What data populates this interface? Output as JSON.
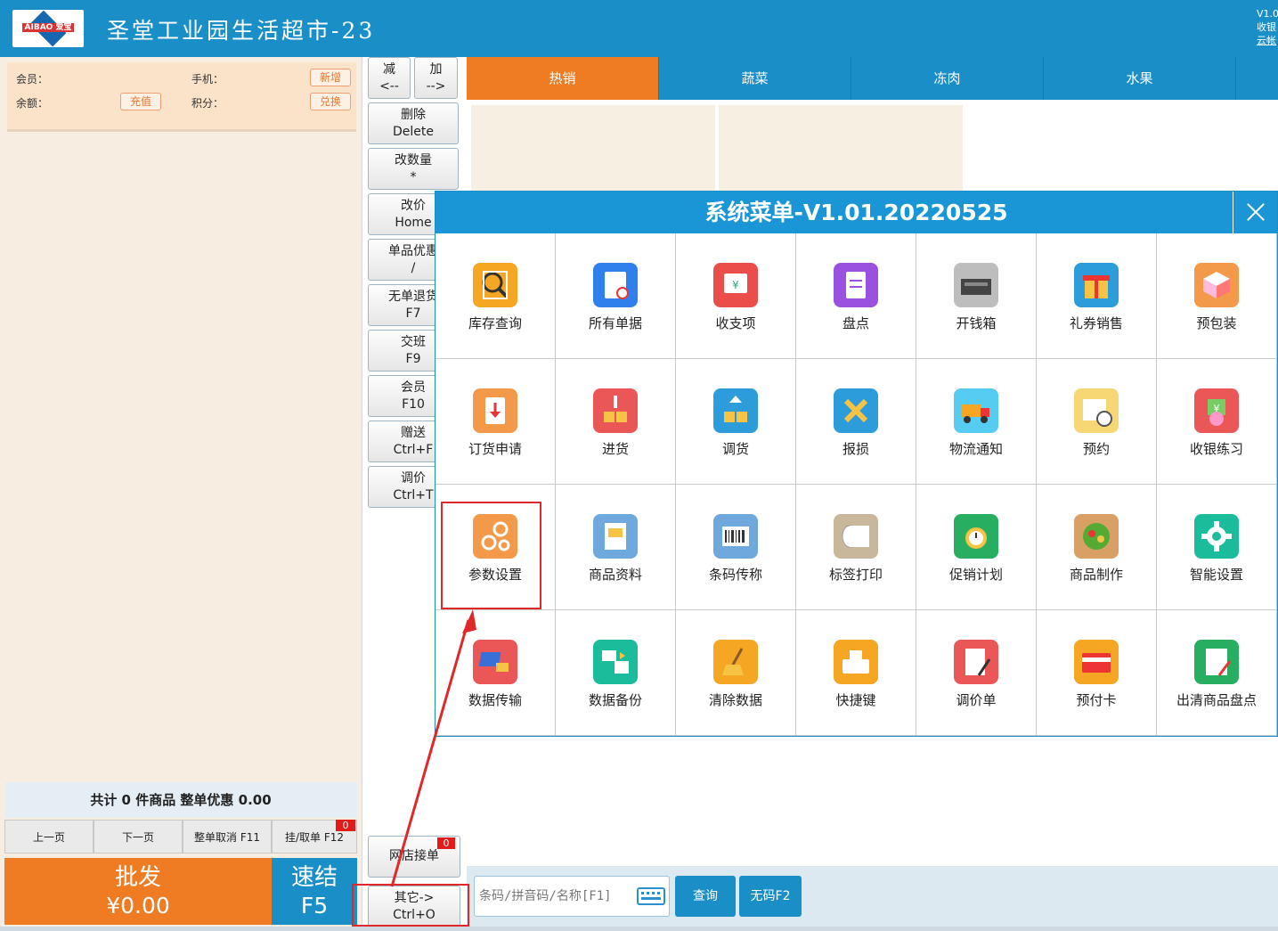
{
  "header": {
    "logo_text": "AIBAO 爱宝",
    "store_name": "圣堂工业园生活超市-23",
    "version": "V1.0",
    "cashier": "收银",
    "cloud_link": "云帐"
  },
  "member": {
    "member_label": "会员：",
    "phone_label": "手机：",
    "balance_label": "余额：",
    "points_label": "积分：",
    "recharge_btn": "充值",
    "new_btn": "新增",
    "redeem_btn": "兑换"
  },
  "summary": "共计 0 件商品 整单优惠 0.00",
  "pager": {
    "prev": "上一页",
    "next": "下一页",
    "cancel_all": "整单取消 F11",
    "hold": "挂/取单 F12",
    "hold_badge": "0"
  },
  "wholesale": {
    "label": "批发",
    "amount": "¥0.00"
  },
  "quick_settle": {
    "label": "速结",
    "key": "F5"
  },
  "functions": [
    {
      "name": "minus",
      "l1": "减",
      "l2": "<--"
    },
    {
      "name": "plus",
      "l1": "加",
      "l2": "-->"
    },
    {
      "name": "delete",
      "l1": "删除",
      "l2": "Delete"
    },
    {
      "name": "change-qty",
      "l1": "改数量",
      "l2": "*"
    },
    {
      "name": "change-price",
      "l1": "改价",
      "l2": "Home"
    },
    {
      "name": "item-discount",
      "l1": "单品优惠",
      "l2": "/"
    },
    {
      "name": "no-receipt-return",
      "l1": "无单退货",
      "l2": "F7"
    },
    {
      "name": "shift",
      "l1": "交班",
      "l2": "F9"
    },
    {
      "name": "member",
      "l1": "会员",
      "l2": "F10"
    },
    {
      "name": "gift",
      "l1": "赠送",
      "l2": "Ctrl+F"
    },
    {
      "name": "adjust-price",
      "l1": "调价",
      "l2": "Ctrl+T"
    }
  ],
  "online_orders": {
    "label": "网店接单",
    "badge": "0"
  },
  "other": {
    "l1": "其它->",
    "l2": "Ctrl+O"
  },
  "tabs": [
    "热销",
    "蔬菜",
    "冻肉",
    "水果"
  ],
  "search": {
    "placeholder": "条码/拼音码/名称[F1]",
    "query_btn": "查询",
    "nocode_btn": "无码F2"
  },
  "modal": {
    "title": "系统菜单-V1.01.20220525",
    "items": [
      {
        "label": "库存查询",
        "icon": "inventory-search-icon",
        "color": "#f5a623"
      },
      {
        "label": "所有单据",
        "icon": "all-documents-icon",
        "color": "#2f80ed"
      },
      {
        "label": "收支项",
        "icon": "income-expense-icon",
        "color": "#eb4d4b"
      },
      {
        "label": "盘点",
        "icon": "stocktake-icon",
        "color": "#9b51e0"
      },
      {
        "label": "开钱箱",
        "icon": "cash-drawer-icon",
        "color": "#bdbdbd"
      },
      {
        "label": "礼券销售",
        "icon": "gift-voucher-icon",
        "color": "#2d9cdb"
      },
      {
        "label": "预包装",
        "icon": "prepackage-icon",
        "color": "#f2994a"
      },
      {
        "label": "订货申请",
        "icon": "order-request-icon",
        "color": "#f2994a"
      },
      {
        "label": "进货",
        "icon": "purchase-icon",
        "color": "#eb5757"
      },
      {
        "label": "调货",
        "icon": "transfer-icon",
        "color": "#2d9cdb"
      },
      {
        "label": "报损",
        "icon": "damage-report-icon",
        "color": "#2d9cdb"
      },
      {
        "label": "物流通知",
        "icon": "logistics-icon",
        "color": "#56ccf2"
      },
      {
        "label": "预约",
        "icon": "appointment-icon",
        "color": "#f7d774"
      },
      {
        "label": "收银练习",
        "icon": "cashier-practice-icon",
        "color": "#eb5757"
      },
      {
        "label": "参数设置",
        "icon": "parameter-settings-icon",
        "color": "#f2994a"
      },
      {
        "label": "商品资料",
        "icon": "product-info-icon",
        "color": "#6fa8dc"
      },
      {
        "label": "条码传称",
        "icon": "barcode-scale-icon",
        "color": "#6fa8dc"
      },
      {
        "label": "标签打印",
        "icon": "label-print-icon",
        "color": "#c9b79c"
      },
      {
        "label": "促销计划",
        "icon": "promotion-plan-icon",
        "color": "#27ae60"
      },
      {
        "label": "商品制作",
        "icon": "product-making-icon",
        "color": "#d9a066"
      },
      {
        "label": "智能设置",
        "icon": "smart-settings-icon",
        "color": "#1abc9c"
      },
      {
        "label": "数据传输",
        "icon": "data-transfer-icon",
        "color": "#eb5757"
      },
      {
        "label": "数据备份",
        "icon": "data-backup-icon",
        "color": "#1abc9c"
      },
      {
        "label": "清除数据",
        "icon": "clear-data-icon",
        "color": "#f5a623"
      },
      {
        "label": "快捷键",
        "icon": "shortcut-key-icon",
        "color": "#f5a623"
      },
      {
        "label": "调价单",
        "icon": "price-adjust-icon",
        "color": "#eb5757"
      },
      {
        "label": "预付卡",
        "icon": "prepaid-card-icon",
        "color": "#f5a623"
      },
      {
        "label": "出清商品盘点",
        "icon": "clearance-stocktake-icon",
        "color": "#27ae60"
      }
    ]
  }
}
